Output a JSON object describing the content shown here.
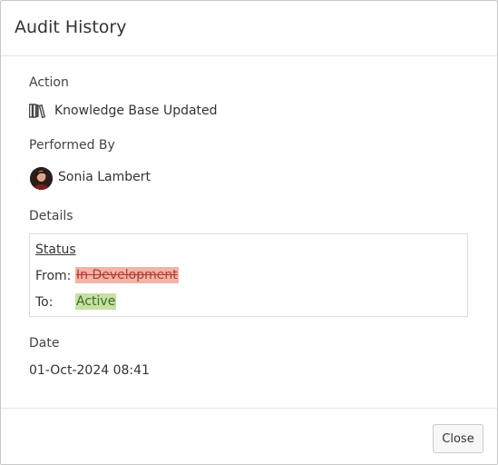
{
  "dialog": {
    "title": "Audit History",
    "close_label": "Close"
  },
  "action": {
    "label": "Action",
    "value": "Knowledge Base Updated",
    "icon": "books-icon"
  },
  "performed_by": {
    "label": "Performed By",
    "name": "Sonia Lambert"
  },
  "details": {
    "label": "Details",
    "field": "Status",
    "from_label": "From:",
    "from_value": "In Development",
    "to_label": "To:",
    "to_value": "Active",
    "colors": {
      "removed_bg": "#f2b3a8",
      "removed_text": "#b03a2e",
      "added_bg": "#c6e0a4",
      "added_text": "#3b6e1c"
    }
  },
  "date": {
    "label": "Date",
    "value": "01-Oct-2024 08:41"
  }
}
